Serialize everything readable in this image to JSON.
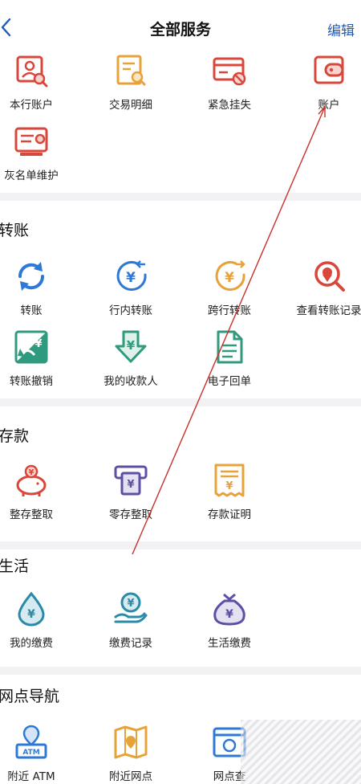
{
  "header": {
    "title": "全部服务",
    "edit_label": "编辑"
  },
  "sections": [
    {
      "title": "",
      "items": [
        {
          "label": "本行账户",
          "icon": "account-search-icon"
        },
        {
          "label": "交易明细",
          "icon": "transaction-detail-icon"
        },
        {
          "label": "紧急挂失",
          "icon": "card-block-icon"
        },
        {
          "label": "账户",
          "icon": "wallet-icon"
        },
        {
          "label": "灰名单维护",
          "icon": "graylist-card-icon"
        }
      ]
    },
    {
      "title": "转账",
      "items": [
        {
          "label": "转账",
          "icon": "refresh-transfer-icon"
        },
        {
          "label": "行内转账",
          "icon": "yuan-in-icon"
        },
        {
          "label": "跨行转账",
          "icon": "yuan-out-icon"
        },
        {
          "label": "查看转账记录",
          "icon": "location-search-icon"
        },
        {
          "label": "转账撤销",
          "icon": "transfer-revoke-icon"
        },
        {
          "label": "我的收款人",
          "icon": "payee-download-icon"
        },
        {
          "label": "电子回单",
          "icon": "e-receipt-icon"
        }
      ]
    },
    {
      "title": "存款",
      "items": [
        {
          "label": "整存整取",
          "icon": "piggy-bank-icon"
        },
        {
          "label": "零存整取",
          "icon": "atm-deposit-icon"
        },
        {
          "label": "存款证明",
          "icon": "deposit-certificate-icon"
        }
      ]
    },
    {
      "title": "生活",
      "items": [
        {
          "label": "我的缴费",
          "icon": "water-drop-yuan-icon"
        },
        {
          "label": "缴费记录",
          "icon": "hand-coin-icon"
        },
        {
          "label": "生活缴费",
          "icon": "money-bag-icon"
        }
      ]
    },
    {
      "title": "网点导航",
      "items": [
        {
          "label": "附近 ATM",
          "icon": "atm-location-icon"
        },
        {
          "label": "附近网点",
          "icon": "map-location-icon"
        },
        {
          "label": "网点查",
          "icon": "branch-browser-icon"
        }
      ]
    }
  ],
  "colors": {
    "blue": "#2e78d6",
    "orange": "#e8a23a",
    "red": "#d9463a",
    "green": "#2f9a7d",
    "purple": "#5b4fa6",
    "accent": "#1e5bb8"
  }
}
